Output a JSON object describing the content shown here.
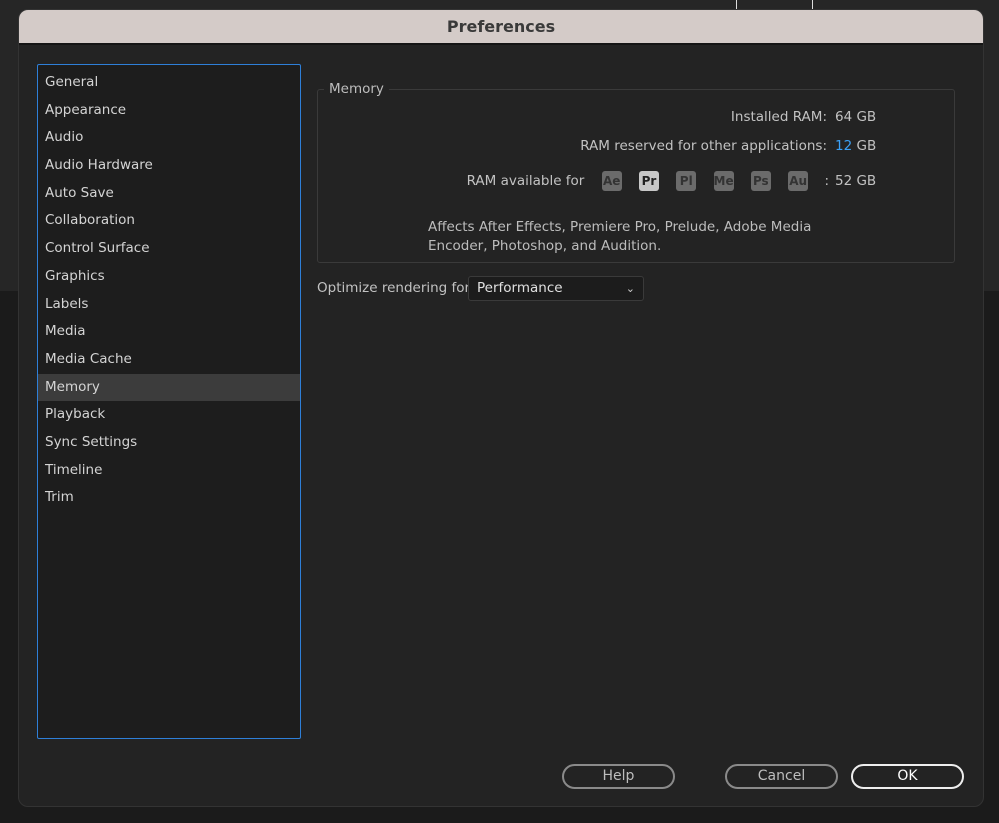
{
  "window": {
    "title": "Preferences"
  },
  "sidebar": {
    "items": [
      {
        "label": "General"
      },
      {
        "label": "Appearance"
      },
      {
        "label": "Audio"
      },
      {
        "label": "Audio Hardware"
      },
      {
        "label": "Auto Save"
      },
      {
        "label": "Collaboration"
      },
      {
        "label": "Control Surface"
      },
      {
        "label": "Graphics"
      },
      {
        "label": "Labels"
      },
      {
        "label": "Media"
      },
      {
        "label": "Media Cache"
      },
      {
        "label": "Memory",
        "selected": true
      },
      {
        "label": "Playback"
      },
      {
        "label": "Sync Settings"
      },
      {
        "label": "Timeline"
      },
      {
        "label": "Trim"
      }
    ]
  },
  "memory": {
    "legend": "Memory",
    "installed_label": "Installed RAM:",
    "installed_value": "64 GB",
    "reserved_label": "RAM reserved for other applications:",
    "reserved_value": "12",
    "reserved_unit": "GB",
    "available_label": "RAM available for",
    "apps": [
      "Ae",
      "Pr",
      "Pl",
      "Me",
      "Ps",
      "Au"
    ],
    "active_app": "Pr",
    "available_sep": ":",
    "available_value": "52 GB",
    "note": "Affects After Effects, Premiere Pro, Prelude, Adobe Media Encoder, Photoshop, and Audition."
  },
  "optimize": {
    "label": "Optimize rendering for:",
    "value": "Performance"
  },
  "buttons": {
    "help": "Help",
    "cancel": "Cancel",
    "ok": "OK"
  },
  "colors": {
    "accent": "#3ba0f5",
    "selection_border": "#2e7fd8"
  }
}
